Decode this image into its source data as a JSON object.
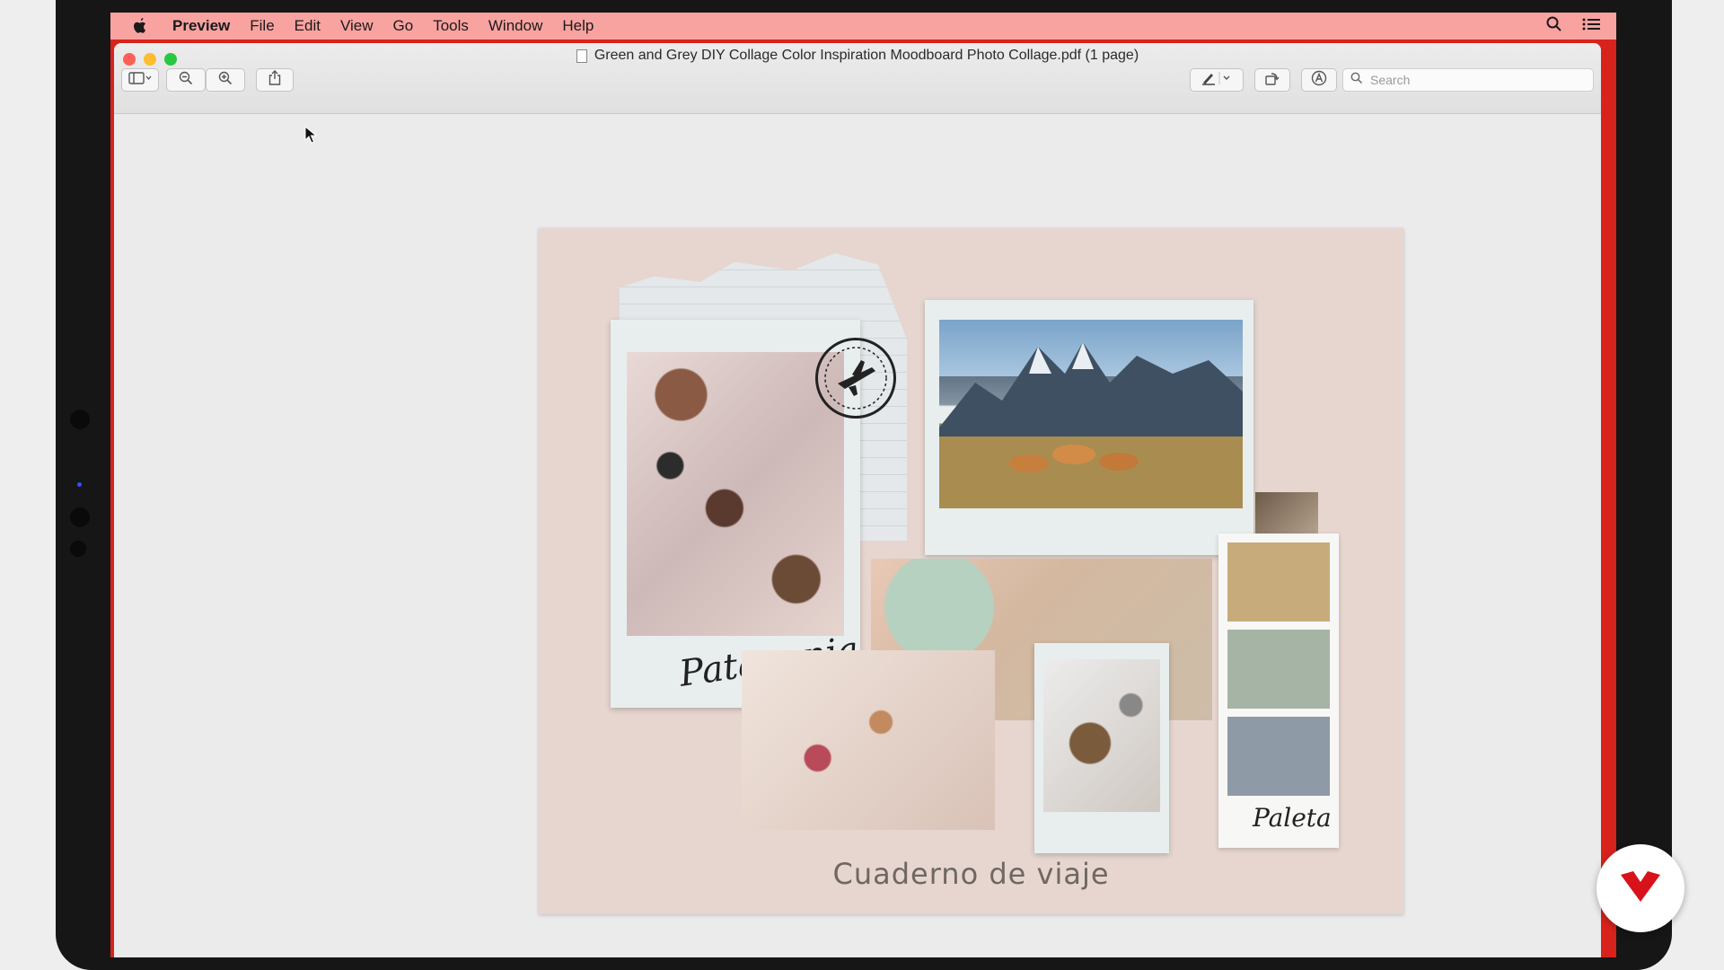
{
  "menubar": {
    "app_name": "Preview",
    "items": [
      "File",
      "Edit",
      "View",
      "Go",
      "Tools",
      "Window",
      "Help"
    ]
  },
  "window": {
    "title": "Green and Grey DIY Collage Color Inspiration Moodboard Photo Collage.pdf (1 page)",
    "search_placeholder": "Search"
  },
  "document": {
    "photo_label_1": "Patagonia",
    "palette_label": "Paleta",
    "title": "Cuaderno de viaje",
    "palette_colors": [
      "#c8ab7b",
      "#a6b4a6",
      "#8e9aa6"
    ]
  },
  "colors": {
    "menubar_bg": "#f9a3a1",
    "screen_accent": "#d8221c",
    "page_bg": "#e6d6cf"
  },
  "icons": {
    "apple": "apple-logo-icon",
    "spotlight": "search-icon",
    "control_center": "list-icon",
    "sidebar": "sidebar-icon",
    "zoom_out": "zoom-out-icon",
    "zoom_in": "zoom-in-icon",
    "share": "share-icon",
    "markup": "pen-icon",
    "rotate": "rotate-icon",
    "annotate": "markup-circle-icon"
  }
}
